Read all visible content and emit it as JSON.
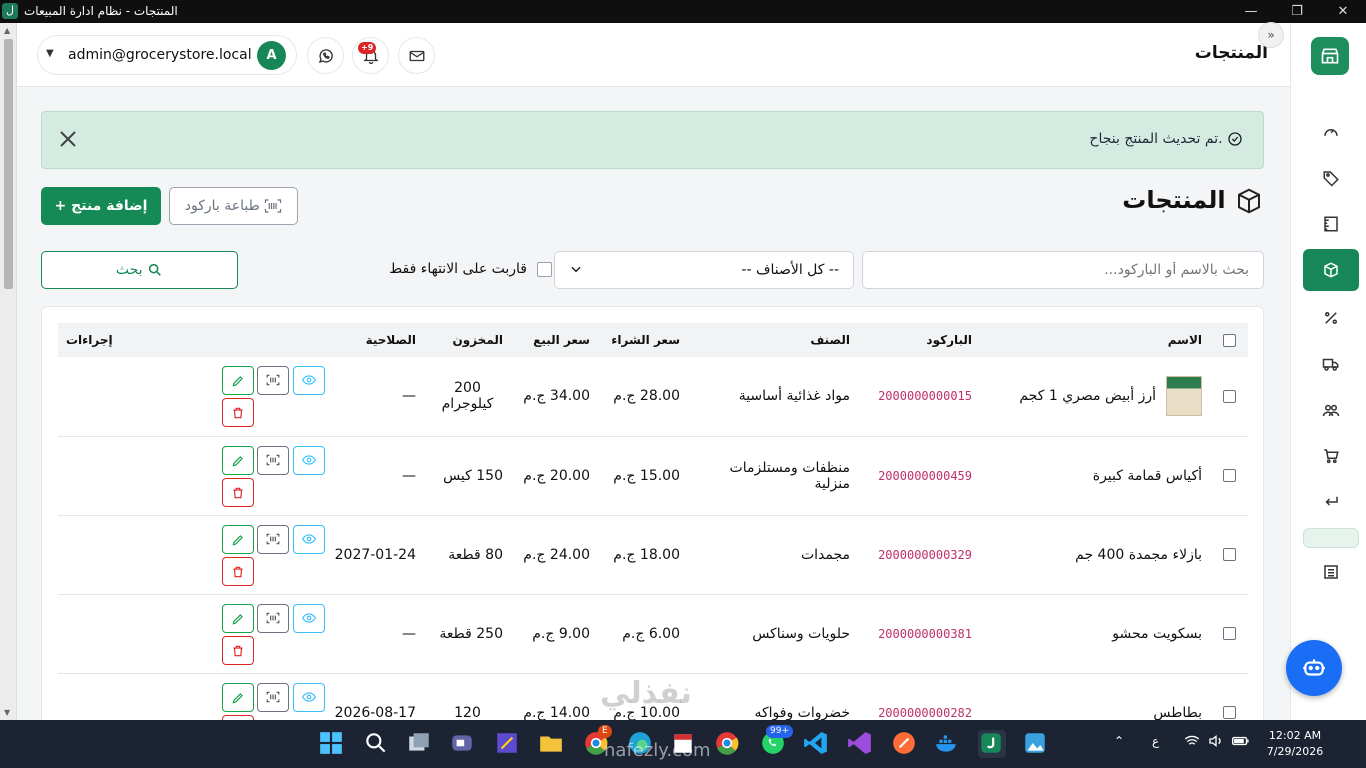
{
  "window": {
    "title": "المنتجات - نظام ادارة المبيعات",
    "app_icon_letter": "ل"
  },
  "header": {
    "user_email": "admin@grocerystore.local",
    "avatar_letter": "A",
    "notification_badge": "+9",
    "page_title": "المنتجات"
  },
  "alert": {
    "message": "تم تحديث المنتج بنجاح."
  },
  "section": {
    "title": "المنتجات",
    "add_button": "إضافة منتج",
    "print_barcode_button": "طباعة باركود"
  },
  "filters": {
    "search_placeholder": "بحث بالاسم أو الباركود...",
    "category_selected": "-- كل الأصناف --",
    "expiring_label": "قاربت على الانتهاء فقط",
    "search_button": "بحث"
  },
  "table": {
    "headers": {
      "name": "الاسم",
      "barcode": "الباركود",
      "category": "الصنف",
      "buy_price": "سعر الشراء",
      "sell_price": "سعر البيع",
      "stock": "المخزون",
      "expiry": "الصلاحية",
      "actions": "إجراءات"
    },
    "rows": [
      {
        "name": "أرز أبيض مصري 1 كجم",
        "barcode": "2000000000015",
        "category": "مواد غذائية أساسية",
        "buy_price": "28.00 ج.م",
        "sell_price": "34.00 ج.م",
        "stock": "200 كيلوجرام",
        "expiry": "—"
      },
      {
        "name": "أكياس قمامة كبيرة",
        "barcode": "2000000000459",
        "category": "منظفات ومستلزمات منزلية",
        "buy_price": "15.00 ج.م",
        "sell_price": "20.00 ج.م",
        "stock": "150 كيس",
        "expiry": "—"
      },
      {
        "name": "بازلاء مجمدة 400 جم",
        "barcode": "2000000000329",
        "category": "مجمدات",
        "buy_price": "18.00 ج.م",
        "sell_price": "24.00 ج.م",
        "stock": "80 قطعة",
        "expiry": "2027-01-24"
      },
      {
        "name": "بسكويت محشو",
        "barcode": "2000000000381",
        "category": "حلويات وسناكس",
        "buy_price": "6.00 ج.م",
        "sell_price": "9.00 ج.م",
        "stock": "250 قطعة",
        "expiry": "—"
      },
      {
        "name": "بطاطس",
        "barcode": "2000000000282",
        "category": "خضروات وفواكه",
        "buy_price": "10.00 ج.م",
        "sell_price": "14.00 ج.م",
        "stock": "120",
        "expiry": "2026-08-17"
      }
    ]
  },
  "watermark": {
    "text": "نفذلي",
    "domain": "nafezly.com"
  },
  "taskbar": {
    "time": "12:02 AM",
    "date": "7/29/2026",
    "lang": "ع",
    "badge_99": "99+",
    "badge_e": "E"
  },
  "colors": {
    "primary": "#17875a",
    "barcode": "#c0306a",
    "alert_bg": "#d4ebe1",
    "chatbot": "#1a6ef5"
  }
}
